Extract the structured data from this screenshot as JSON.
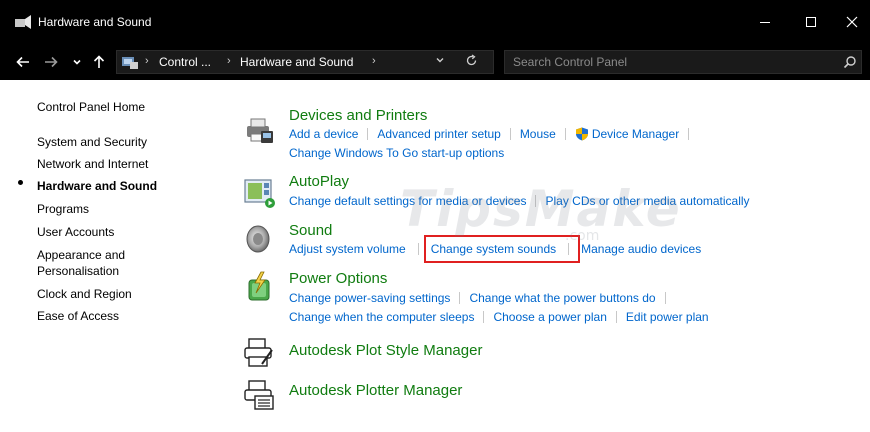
{
  "window": {
    "title": "Hardware and Sound",
    "minimize_glyph": "—",
    "maximize_glyph": "☐",
    "close_glyph": "✕"
  },
  "addressbar": {
    "back_glyph": "←",
    "forward_glyph": "→",
    "recent_glyph": "⌄",
    "up_glyph": "↑",
    "crumbs": [
      "Control ...",
      "Hardware and Sound"
    ],
    "crumb_separator": "›",
    "dropdown_glyph": "⌄",
    "refresh_glyph": "↻",
    "search_placeholder": "Search Control Panel"
  },
  "sidebar": {
    "items": [
      {
        "label": "Control Panel Home"
      },
      {
        "label": "System and Security"
      },
      {
        "label": "Network and Internet"
      },
      {
        "label": "Hardware and Sound",
        "active": true
      },
      {
        "label": "Programs"
      },
      {
        "label": "User Accounts"
      },
      {
        "label": "Appearance and"
      },
      {
        "label": "Personalisation"
      },
      {
        "label": "Clock and Region"
      },
      {
        "label": "Ease of Access"
      }
    ]
  },
  "categories": {
    "devices": {
      "title": "Devices and Printers",
      "links": [
        "Add a device",
        "Advanced printer setup",
        "Mouse",
        "Device Manager",
        "Change Windows To Go start-up options"
      ]
    },
    "autoplay": {
      "title": "AutoPlay",
      "links": [
        "Change default settings for media or devices",
        "Play CDs or other media automatically"
      ]
    },
    "sound": {
      "title": "Sound",
      "links": [
        "Adjust system volume",
        "Change system sounds",
        "Manage audio devices"
      ]
    },
    "power": {
      "title": "Power Options",
      "links": [
        "Change power-saving settings",
        "Change what the power buttons do",
        "Change when the computer sleeps",
        "Choose a power plan",
        "Edit power plan"
      ]
    },
    "plotstyle": {
      "title": "Autodesk Plot Style Manager"
    },
    "plotter": {
      "title": "Autodesk Plotter Manager"
    }
  },
  "watermark": {
    "text": "TipsMake",
    "suffix": ".com"
  },
  "colors": {
    "title_bar": "#000000",
    "category_green": "#107c10",
    "link_blue": "#0066cc",
    "highlight_red": "#e02020"
  }
}
